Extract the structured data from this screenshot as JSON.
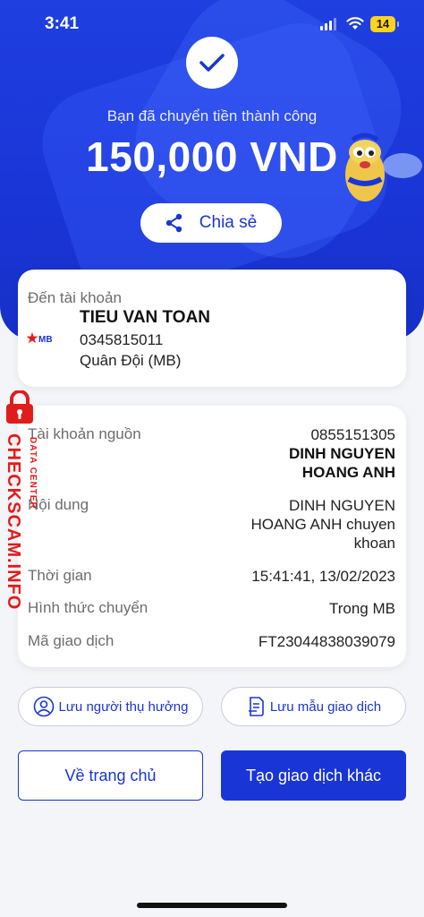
{
  "status_bar": {
    "time": "3:41",
    "battery": "14"
  },
  "header": {
    "success_text": "Bạn đã chuyển tiền thành công",
    "amount": "150,000 VND",
    "share_label": "Chia sẻ"
  },
  "recipient": {
    "label": "Đến tài khoản",
    "bank_logo_text": "MB",
    "name": "TIEU VAN TOAN",
    "account": "0345815011",
    "bank": "Quân Đội (MB)"
  },
  "details": {
    "source_label": "Tài khoản nguồn",
    "source_account": "0855151305",
    "source_name_line1": "DINH NGUYEN",
    "source_name_line2": "HOANG ANH",
    "content_label": "Nội dung",
    "content_line1": "DINH NGUYEN",
    "content_line2": "HOANG ANH chuyen",
    "content_line3": "khoan",
    "time_label": "Thời gian",
    "time_value": "15:41:41, 13/02/2023",
    "method_label": "Hình thức chuyển",
    "method_value": "Trong MB",
    "txn_label": "Mã giao dịch",
    "txn_value": "FT23044838039079"
  },
  "watermark": {
    "text": "CHECKSCAM.INFO",
    "sub": "DATA CENTER"
  },
  "actions": {
    "save_recipient": "Lưu người thụ hưởng",
    "save_template": "Lưu mẫu giao dịch",
    "home": "Về trang chủ",
    "new_transaction": "Tạo giao dịch khác"
  },
  "colors": {
    "primary": "#1a35d6",
    "watermark": "#e11c1c",
    "battery": "#ffd21f"
  }
}
